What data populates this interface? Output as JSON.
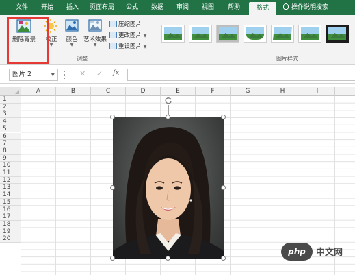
{
  "tabs": [
    {
      "label": "文件",
      "active": false
    },
    {
      "label": "开始",
      "active": false
    },
    {
      "label": "插入",
      "active": false
    },
    {
      "label": "页面布局",
      "active": false
    },
    {
      "label": "公式",
      "active": false
    },
    {
      "label": "数据",
      "active": false
    },
    {
      "label": "审阅",
      "active": false
    },
    {
      "label": "视图",
      "active": false
    },
    {
      "label": "帮助",
      "active": false
    },
    {
      "label": "格式",
      "active": true
    }
  ],
  "tell_me": "操作说明搜索",
  "ribbon": {
    "remove_background": "删除背景",
    "corrections": "校正",
    "color": "颜色",
    "artistic_effects": "艺术效果",
    "compress_pictures": "压缩图片",
    "change_picture": "更改图片",
    "reset_picture": "重设图片",
    "adjust_group": "调整",
    "picture_styles_group": "图片样式"
  },
  "formula_bar": {
    "name_box": "图片 2",
    "cancel": "✕",
    "enter": "✓",
    "fx": "fx",
    "value": ""
  },
  "columns": [
    "A",
    "B",
    "C",
    "D",
    "E",
    "F",
    "G",
    "H",
    "I"
  ],
  "rows": [
    "1",
    "2",
    "3",
    "4",
    "5",
    "6",
    "7",
    "8",
    "9",
    "10",
    "11",
    "12",
    "13",
    "14",
    "15",
    "16",
    "17",
    "18",
    "19",
    "20"
  ],
  "watermark": {
    "logo": "php",
    "text": "中文网"
  },
  "colors": {
    "accent": "#217346",
    "highlight": "#e53935"
  }
}
